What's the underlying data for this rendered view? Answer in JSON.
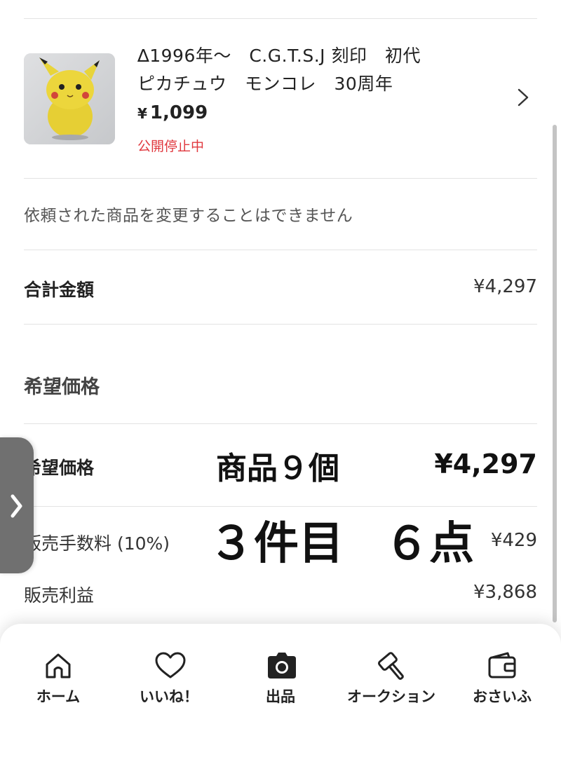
{
  "product": {
    "title_line1": "∆1996年〜　C.G.T.S.J 刻印　初代",
    "title_line2": "ピカチュウ　モンコレ　30周年",
    "price_symbol": "¥",
    "price_value": "1,099",
    "status": "公開停止中",
    "image_alt": "ピカチュウ フィギュア"
  },
  "notice": "依頼された商品を変更することはできません",
  "total": {
    "label": "合計金額",
    "value": "¥4,297"
  },
  "desired_section": {
    "title": "希望価格"
  },
  "desired_price": {
    "label": "希望価格",
    "value": "¥4,297"
  },
  "fee": {
    "label": "販売手数料 (10%)",
    "value": "¥429"
  },
  "profit": {
    "label": "販売利益",
    "value": "¥3,868"
  },
  "overlay": {
    "line1": "商品９個",
    "line2a": "３件目",
    "line2b": "６点"
  },
  "tabbar": {
    "items": [
      {
        "label": "ホーム",
        "icon": "home-icon"
      },
      {
        "label": "いいね！",
        "icon": "heart-icon"
      },
      {
        "label": "出品",
        "icon": "camera-icon"
      },
      {
        "label": "オークション",
        "icon": "gavel-icon"
      },
      {
        "label": "おさいふ",
        "icon": "wallet-icon"
      }
    ]
  },
  "colors": {
    "status_red": "#e0383e",
    "divider": "#e3e3e3",
    "side_tab": "#707070"
  }
}
